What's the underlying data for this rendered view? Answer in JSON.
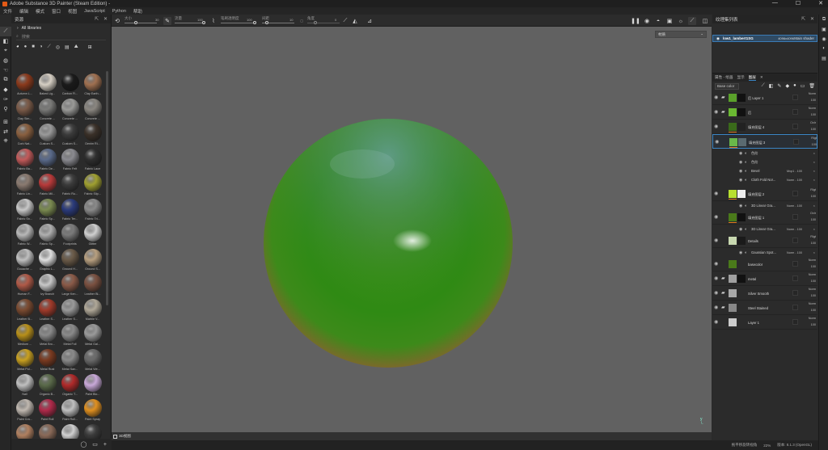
{
  "titlebar": {
    "title": "Adobe Substance 3D Painter (Steam Edition) - ",
    "controls": [
      "—",
      "☐",
      "✕"
    ]
  },
  "menu": [
    "文件",
    "编辑",
    "模式",
    "窗口",
    "视图",
    "JavaScript",
    "Python",
    "帮助"
  ],
  "toolbar": {
    "size_label": "大小",
    "size_value": "30",
    "flow_label": "流量",
    "flow_value": "100",
    "stroke_opacity_label": "笔刷透明度",
    "stroke_opacity_value": "100",
    "spacing_label": "间距",
    "spacing_value": "10",
    "angle_label": "角度",
    "angle_value": "0"
  },
  "shelf": {
    "title": "资源",
    "category": "All libraries",
    "search_placeholder": "搜索",
    "materials": [
      {
        "label": "Autumn L...",
        "color": "#8b3a1c"
      },
      {
        "label": "Baked Lig...",
        "color": "#d6cfc4"
      },
      {
        "label": "Carbon Fi...",
        "color": "#1a1a1a"
      },
      {
        "label": "Clay Earth...",
        "color": "#a07050"
      },
      {
        "label": "Clay Sim...",
        "color": "#7a5a48"
      },
      {
        "label": "Concrete ...",
        "color": "#7a7a78"
      },
      {
        "label": "Concrete ...",
        "color": "#9a9a98"
      },
      {
        "label": "Concrete ...",
        "color": "#8a8680"
      },
      {
        "label": "Cork Nat...",
        "color": "#8a6040"
      },
      {
        "label": "Custom S...",
        "color": "#9a9a9a"
      },
      {
        "label": "Custom S...",
        "color": "#3a3a3a"
      },
      {
        "label": "Denim Ri...",
        "color": "#3a3028"
      },
      {
        "label": "Fabric Ba...",
        "color": "#c25a5a"
      },
      {
        "label": "Fabric De...",
        "color": "#5a6a8a"
      },
      {
        "label": "Fabric Felt",
        "color": "#8a8a90"
      },
      {
        "label": "Fabric Lace",
        "color": "#2e2e2e"
      },
      {
        "label": "Fabric Lin...",
        "color": "#8a7a70"
      },
      {
        "label": "Fabric Mil...",
        "color": "#b83a3a"
      },
      {
        "label": "Fabric Ru...",
        "color": "#3a3a3a"
      },
      {
        "label": "Fabric Slip...",
        "color": "#a0a030"
      },
      {
        "label": "Fabric Sn...",
        "color": "#c8c8c8"
      },
      {
        "label": "Fabric Sp...",
        "color": "#7a8a50"
      },
      {
        "label": "Fabric Ter...",
        "color": "#2a3a7a"
      },
      {
        "label": "Fabric Tri...",
        "color": "#8a8a8a"
      },
      {
        "label": "Fabric W...",
        "color": "#b8b8b8"
      },
      {
        "label": "Fabric Sp...",
        "color": "#b0b0b0"
      },
      {
        "label": "Footprints",
        "color": "#7a7a7a"
      },
      {
        "label": "Glitter",
        "color": "#d0d0d0"
      },
      {
        "label": "Gouache ...",
        "color": "#c0c0c0"
      },
      {
        "label": "Graphic L...",
        "color": "#e0e0e0"
      },
      {
        "label": "Ground H...",
        "color": "#6a5a48"
      },
      {
        "label": "Ground S...",
        "color": "#b8a080"
      },
      {
        "label": "Human F...",
        "color": "#b05a48"
      },
      {
        "label": "Ivy Branch",
        "color": "#c8c8c8"
      },
      {
        "label": "Large Ken...",
        "color": "#8a5a48"
      },
      {
        "label": "Leather Bl...",
        "color": "#7a5040"
      },
      {
        "label": "Leather B...",
        "color": "#7a4a30"
      },
      {
        "label": "Leather S...",
        "color": "#a03a2a"
      },
      {
        "label": "Leather S...",
        "color": "#9a9a9a"
      },
      {
        "label": "Marble V...",
        "color": "#b0a898"
      },
      {
        "label": "Medium ...",
        "color": "#b8901a"
      },
      {
        "label": "Metal Bro...",
        "color": "#8a8a8a"
      },
      {
        "label": "Metal Foil",
        "color": "#8a8a8a"
      },
      {
        "label": "Metal Gal...",
        "color": "#9a9a9a"
      },
      {
        "label": "Metal Pol...",
        "color": "#c8a020"
      },
      {
        "label": "Metal Rust",
        "color": "#7a3a20"
      },
      {
        "label": "Metal San...",
        "color": "#8a8a8a"
      },
      {
        "label": "Metal We...",
        "color": "#6a6a6a"
      },
      {
        "label": "Nail",
        "color": "#c0c0c0"
      },
      {
        "label": "Organic B...",
        "color": "#5a6a4a"
      },
      {
        "label": "Organic T...",
        "color": "#b02a2a"
      },
      {
        "label": "Paint Blo...",
        "color": "#c8a8d8"
      },
      {
        "label": "Paint Cra...",
        "color": "#c0b8b0"
      },
      {
        "label": "Paint Roll",
        "color": "#b02a4a"
      },
      {
        "label": "Paint Roll...",
        "color": "#c0c0c0"
      },
      {
        "label": "Paint Spray",
        "color": "#e09020"
      },
      {
        "label": "",
        "color": "#b08060"
      },
      {
        "label": "",
        "color": "#8a6a58"
      },
      {
        "label": "",
        "color": "#d0d0d0"
      },
      {
        "label": "",
        "color": "#3a3a3a"
      }
    ]
  },
  "viewport": {
    "mode": "材质",
    "tab_label": "3D视图",
    "axis": "y"
  },
  "texture_set": {
    "title": "纹理集列表",
    "name": "low1_lambert1SG",
    "resolution": "4096x4096",
    "shader": "Main shader"
  },
  "layers": {
    "tabs": [
      "属性 - 绘画",
      "显示",
      "图层"
    ],
    "blend_mode": "Base color",
    "items": [
      {
        "name": "后 Layer 1",
        "blend": "Norm",
        "opacity": "100",
        "thumb": "#5aa02a",
        "mask": "#111",
        "folder": true
      },
      {
        "name": "后",
        "blend": "Norm",
        "opacity": "100",
        "thumb": "#6ab832",
        "mask": "#111",
        "folder": true
      },
      {
        "name": "填充图层 4",
        "blend": "Ovlr",
        "opacity": "100",
        "thumb": "#3a6a1a",
        "mask": "#222",
        "folder": false
      },
      {
        "name": "填充图层 3",
        "blend": "Rlgt",
        "opacity": "100",
        "thumb": "#6ab84a",
        "mask": "#5a6a70",
        "folder": false
      },
      {
        "name": "填充图层 2",
        "blend": "Rlgt",
        "opacity": "100",
        "thumb": "#b8e030",
        "mask": "#eee",
        "folder": false
      },
      {
        "name": "填充图层 1",
        "blend": "Ovlr",
        "opacity": "100",
        "thumb": "#4a7a1a",
        "mask": "#111",
        "folder": false
      },
      {
        "name": "Details",
        "blend": "Rlgt",
        "opacity": "100",
        "thumb": "#c8d8b0",
        "mask": "#1a1a1a",
        "folder": false
      },
      {
        "name": "basecolor",
        "blend": "Norm",
        "opacity": "100",
        "thumb": "#4a7a1a",
        "mask": "",
        "folder": false
      },
      {
        "name": "metal",
        "blend": "Norm",
        "opacity": "100",
        "thumb": "#a0a0a0",
        "mask": "#111",
        "folder": true
      },
      {
        "name": "Silver Smooth",
        "blend": "Norm",
        "opacity": "100",
        "thumb": "#a8a8a8",
        "mask": "",
        "folder": true
      },
      {
        "name": "Steel Stained",
        "blend": "Norm",
        "opacity": "100",
        "thumb": "#888888",
        "mask": "",
        "folder": true
      },
      {
        "name": "Layer 1",
        "blend": "Norm",
        "opacity": "100",
        "thumb": "#cccccc",
        "mask": "",
        "folder": false
      }
    ],
    "sub_effects": [
      {
        "name": "色阶",
        "mode": ""
      },
      {
        "name": "色阶",
        "mode": ""
      },
      {
        "name": "Bevel",
        "mode": "Mxp1 - 100"
      },
      {
        "name": "Cloth Fold Nor...",
        "mode": "Norm - 100"
      },
      {
        "name": "3D Linear Gra...",
        "mode": "Norm - 100"
      },
      {
        "name": "3D Linear Gra...",
        "mode": "Norm - 100"
      },
      {
        "name": "Gaussian Spot...",
        "mode": "Norm - 100"
      }
    ]
  },
  "status": {
    "hint": "拖平移旋转视角",
    "zoom": "22%",
    "version": "版本: 8.1.3 (OpenGL)"
  }
}
